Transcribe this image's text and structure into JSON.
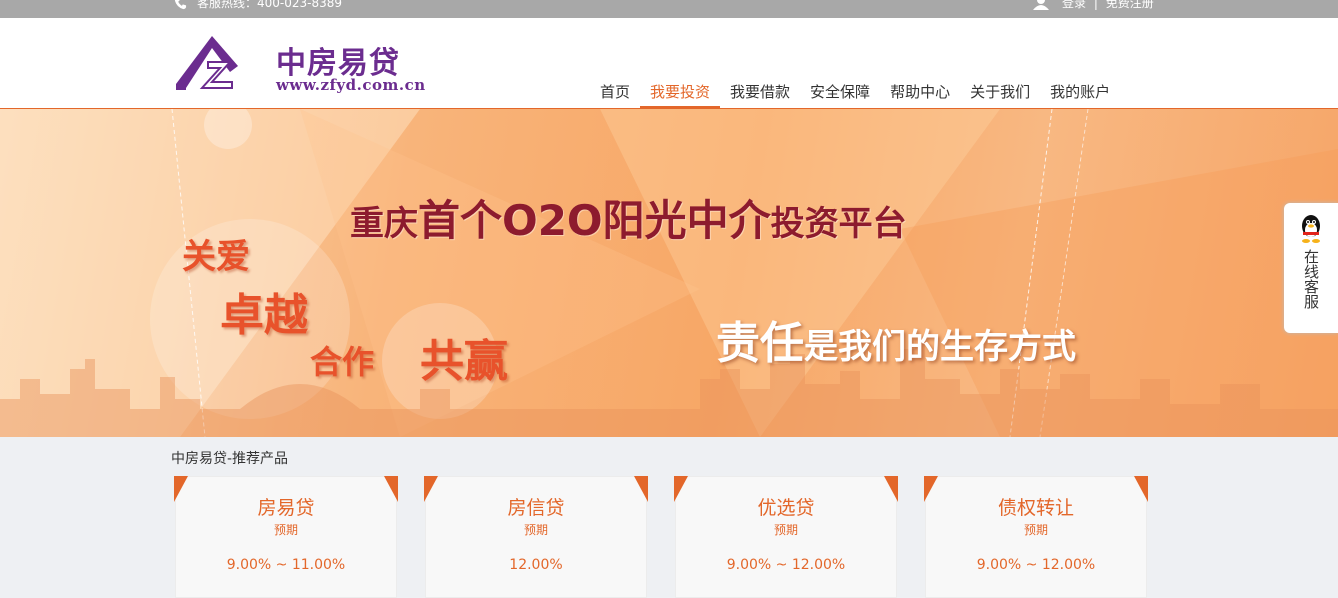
{
  "topbar": {
    "hotline": "客服热线：400-023-8389",
    "login": "登录",
    "divider": "|",
    "register": "免费注册"
  },
  "logo": {
    "name": "中房易贷",
    "url": "www.zfyd.com.cn"
  },
  "nav": {
    "items": [
      {
        "label": "首页"
      },
      {
        "label": "我要投资",
        "active": true
      },
      {
        "label": "我要借款"
      },
      {
        "label": "安全保障"
      },
      {
        "label": "帮助中心"
      },
      {
        "label": "关于我们"
      },
      {
        "label": "我的账户"
      }
    ]
  },
  "banner": {
    "line1_a": "重庆",
    "line1_b": "首个O2O阳光中介",
    "line1_c": "投资平台",
    "word1": "关爱",
    "word2": "卓越",
    "word3": "合作",
    "word4": "共赢",
    "line2_a": "责任",
    "line2_b": "是我们的生存方式"
  },
  "service": {
    "label": "在线客服"
  },
  "products": {
    "title": "中房易贷-推荐产品",
    "cards": [
      {
        "name": "房易贷",
        "sub": "预期",
        "rate": "9.00% ~ 11.00%"
      },
      {
        "name": "房信贷",
        "sub": "预期",
        "rate": "12.00%"
      },
      {
        "name": "优选贷",
        "sub": "预期",
        "rate": "9.00% ~ 12.00%"
      },
      {
        "name": "债权转让",
        "sub": "预期",
        "rate": "9.00% ~ 12.00%"
      }
    ]
  },
  "colors": {
    "accent": "#e3672a",
    "brand": "#6b2c8f",
    "topbar": "#a8a8a8"
  }
}
